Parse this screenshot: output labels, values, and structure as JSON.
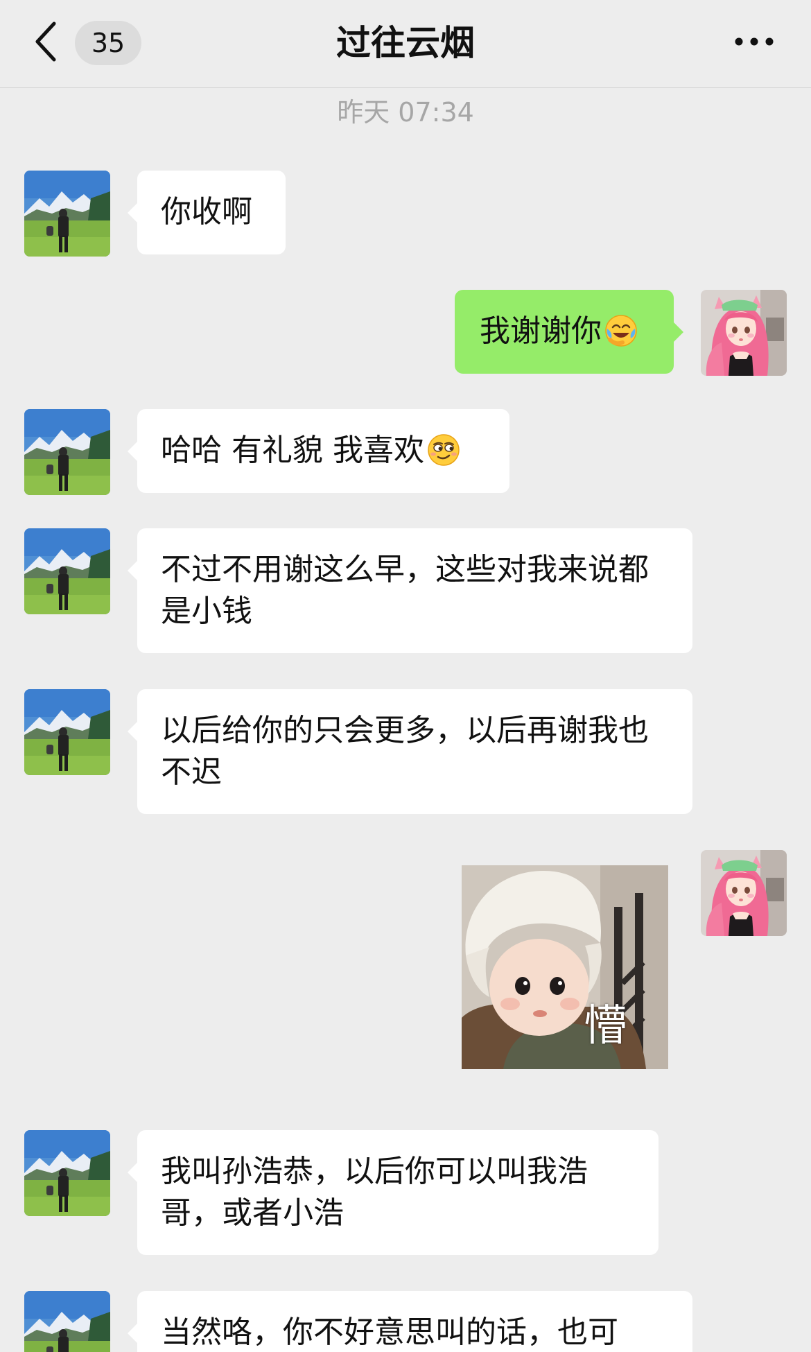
{
  "header": {
    "unread_count": "35",
    "title": "过往云烟"
  },
  "timestamp": "昨天 07:34",
  "messages": [
    {
      "side": "left",
      "text": "你收啊"
    },
    {
      "side": "right",
      "text": "我谢谢你",
      "emoji": "laughing-crying-emoji"
    },
    {
      "side": "left",
      "text": "哈哈 有礼貌 我喜欢",
      "emoji": "smirk-emoji"
    },
    {
      "side": "left",
      "text": "不过不用谢这么早，这些对我来说都是小钱"
    },
    {
      "side": "left",
      "text": "以后给你的只会更多，以后再谢我也不迟"
    },
    {
      "side": "right",
      "type": "sticker",
      "caption": "懵"
    },
    {
      "side": "left",
      "text": "我叫孙浩恭，以后你可以叫我浩哥，或者小浩"
    },
    {
      "side": "left",
      "text": "当然咯，你不好意思叫的话，也可"
    }
  ],
  "colors": {
    "background": "#ededed",
    "incoming_bubble": "#ffffff",
    "outgoing_bubble": "#95ec69",
    "timestamp": "#a6a6a6"
  },
  "icons": {
    "back": "chevron-left-icon",
    "more": "more-dots-icon"
  }
}
